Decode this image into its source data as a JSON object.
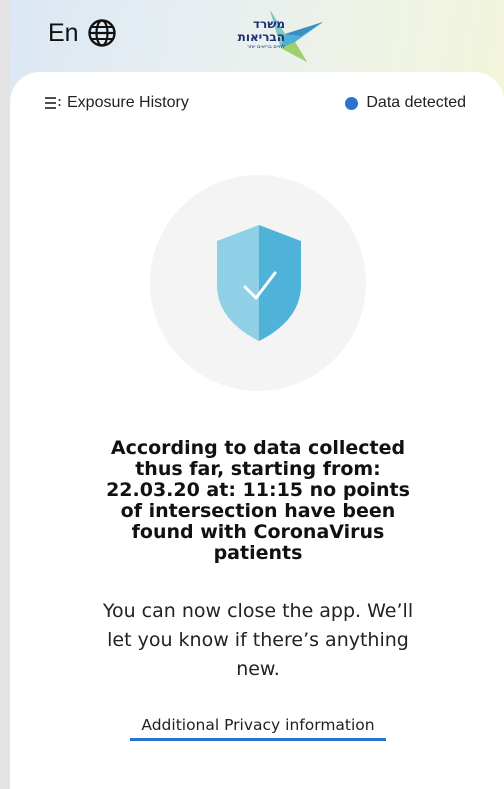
{
  "header": {
    "language_label": "En",
    "language_icon": "globe-icon",
    "logo": {
      "line1": "משרד",
      "line2": "הבריאות",
      "tagline": "לחיים בריאים יותר"
    }
  },
  "topbar": {
    "menu_icon": "menu-icon",
    "menu_label": "Exposure History",
    "status_label": "Data detected",
    "status_color": "#2a72d4"
  },
  "main": {
    "shield_icon": "shield-check-icon",
    "headline": "According to data collected thus far, starting from: 22.03.20 at: 11:15 no points of intersection have been found with CoronaVirus patients",
    "subtext": "You can now close the app. We’ll let you know if there’s anything new.",
    "privacy_link": "Additional Privacy information"
  },
  "colors": {
    "accent": "#2a72d4",
    "shield_light": "#8fd0e6",
    "shield_dark": "#4fb3d9"
  }
}
